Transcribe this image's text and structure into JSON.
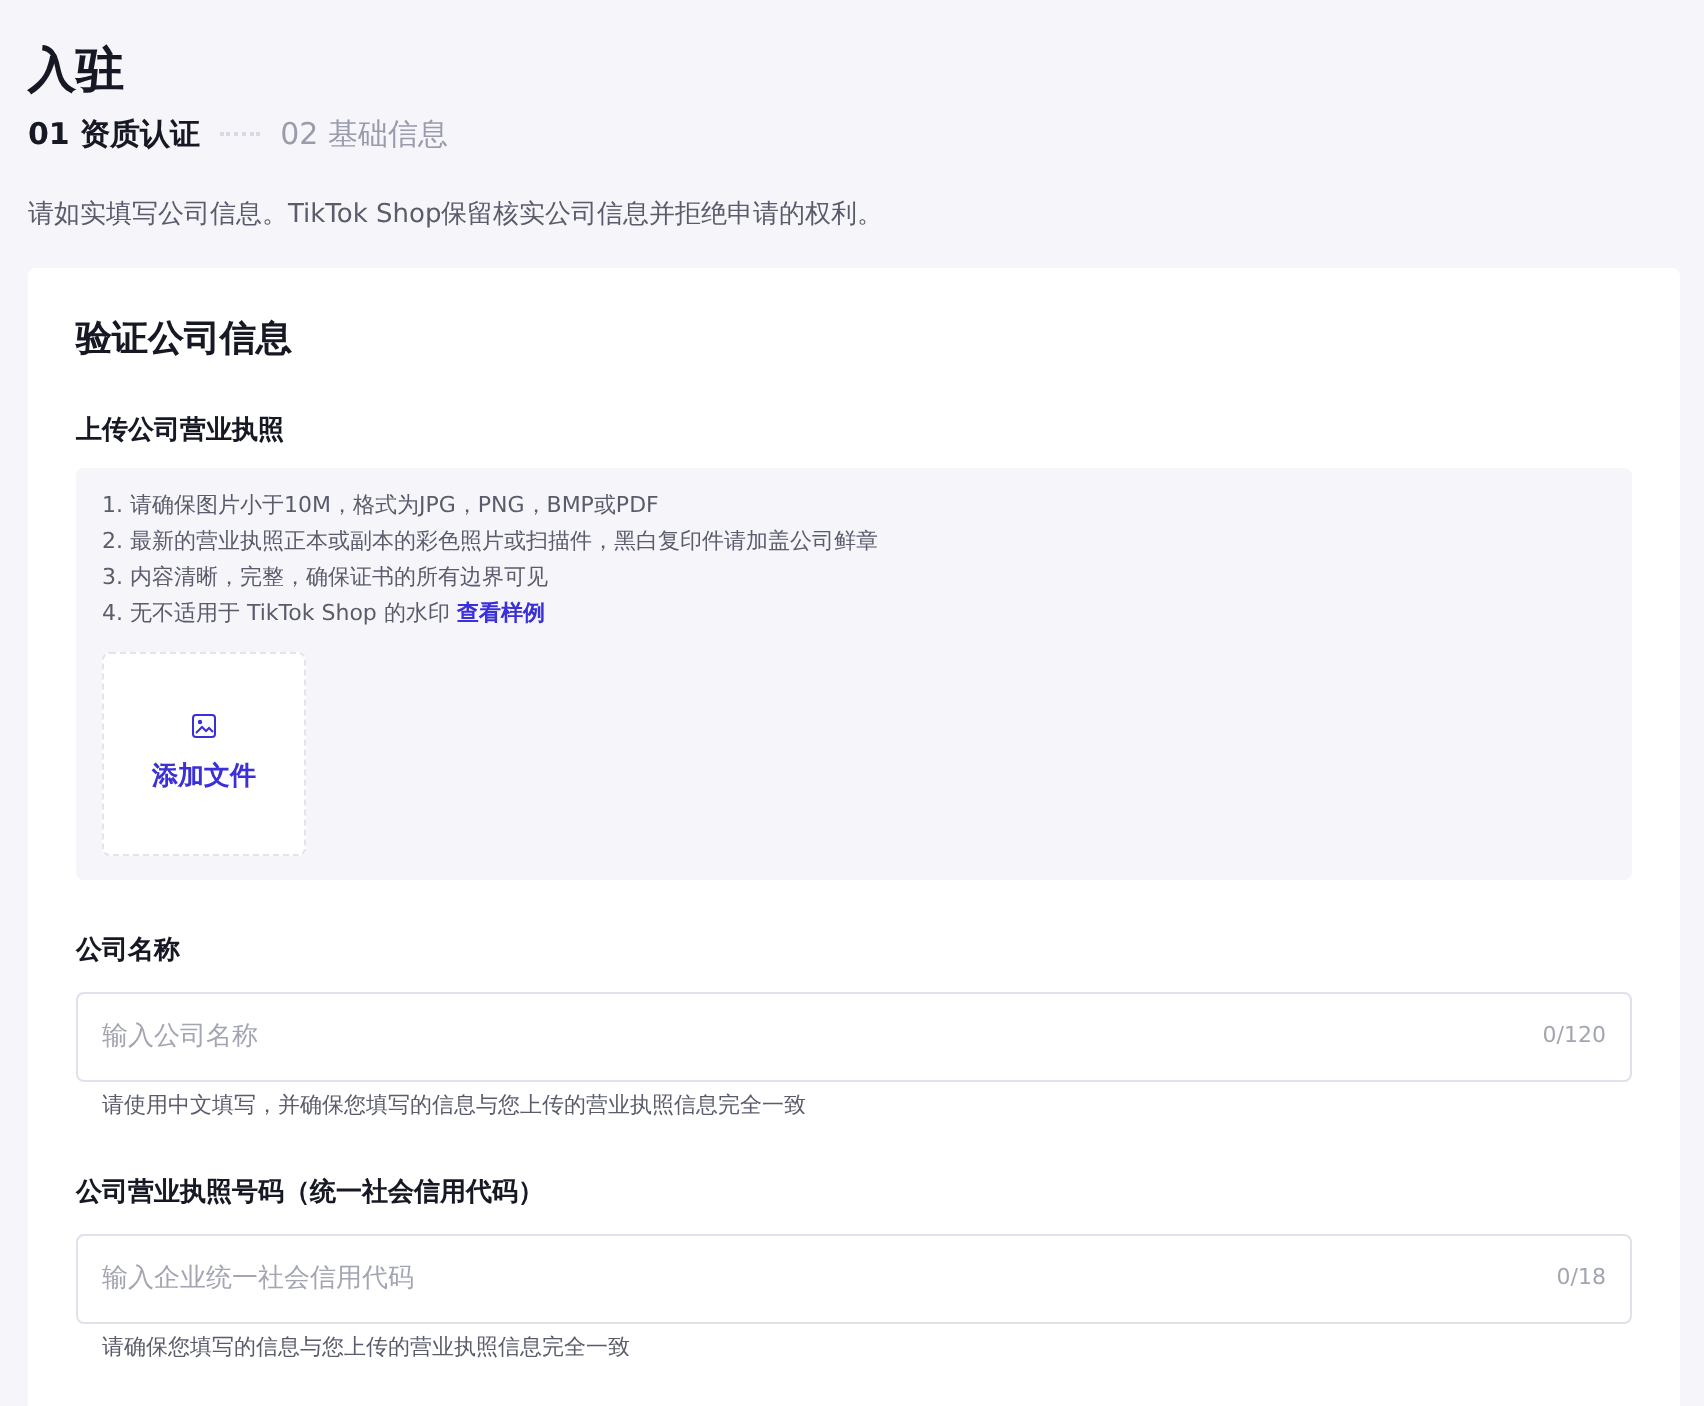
{
  "page": {
    "title": "入驻"
  },
  "steps": [
    {
      "label": "01 资质认证",
      "selected": true
    },
    {
      "label": "02 基础信息",
      "selected": false
    }
  ],
  "notice": "请如实填写公司信息。TikTok Shop保留核实公司信息并拒绝申请的权利。",
  "card": {
    "title": "验证公司信息",
    "upload": {
      "label": "上传公司营业执照",
      "instructions": [
        {
          "text": "1. 请确保图片小于10M，格式为JPG，PNG，BMP或PDF"
        },
        {
          "text": "2. 最新的营业执照正本或副本的彩色照片或扫描件，黑白复印件请加盖公司鲜章"
        },
        {
          "text": "3. 内容清晰，完整，确保证书的所有边界可见"
        },
        {
          "text": "4. 无不适用于 TikTok Shop 的水印",
          "link": "查看样例"
        }
      ],
      "button": "添加文件"
    },
    "fields": [
      {
        "label": "公司名称",
        "placeholder": "输入公司名称",
        "counter": "0/120",
        "help": "请使用中文填写，并确保您填写的信息与您上传的营业执照信息完全一致"
      },
      {
        "label": "公司营业执照号码（统一社会信用代码）",
        "placeholder": "输入企业统一社会信用代码",
        "counter": "0/18",
        "help": "请确保您填写的信息与您上传的营业执照信息完全一致"
      }
    ]
  }
}
